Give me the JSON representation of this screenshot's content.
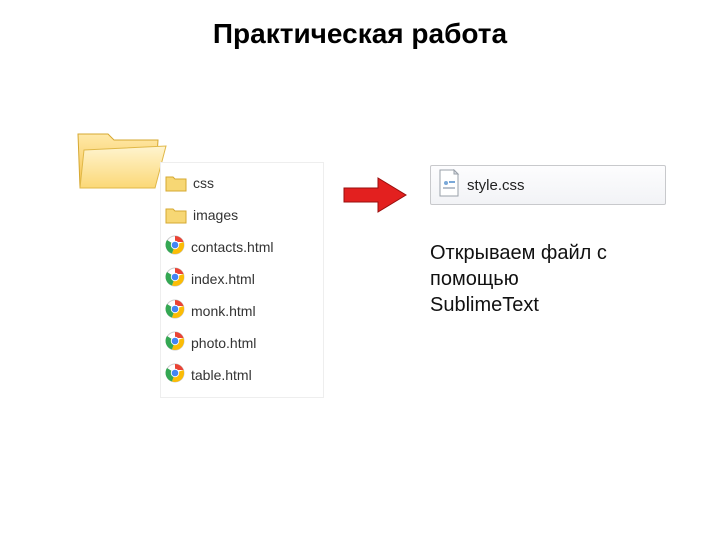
{
  "title": "Практическая работа",
  "file_list": {
    "items": [
      {
        "type": "folder",
        "name": "css"
      },
      {
        "type": "folder",
        "name": "images"
      },
      {
        "type": "html",
        "name": "contacts.html"
      },
      {
        "type": "html",
        "name": "index.html"
      },
      {
        "type": "html",
        "name": "monk.html"
      },
      {
        "type": "html",
        "name": "photo.html"
      },
      {
        "type": "html",
        "name": "table.html"
      }
    ]
  },
  "target_file": {
    "name": "style.css"
  },
  "instruction": "Открываем файл с помощью SublimeText",
  "icons": {
    "folder_large": "folder-icon",
    "folder_small": "folder-icon",
    "chrome": "chrome-icon",
    "css_small": "css-file-icon",
    "arrow": "arrow-icon"
  }
}
